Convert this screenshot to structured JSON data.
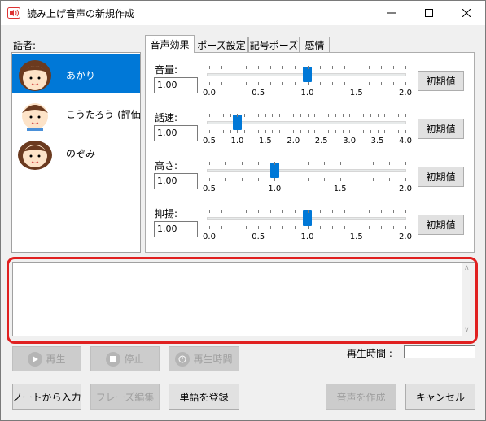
{
  "window": {
    "title": "読み上げ音声の新規作成"
  },
  "speakers": {
    "label": "話者:",
    "items": [
      {
        "name": "あかり",
        "selected": true
      },
      {
        "name": "こうたろう (評価版)",
        "selected": false
      },
      {
        "name": "のぞみ",
        "selected": false
      }
    ]
  },
  "tabs": [
    "音声効果",
    "ポーズ設定",
    "記号ポーズ",
    "感情"
  ],
  "sliders": [
    {
      "label": "音量:",
      "value": "1.00",
      "min": 0,
      "max": 2,
      "current": 1.0,
      "ticks": [
        "0.0",
        "0.5",
        "1.0",
        "1.5",
        "2.0"
      ],
      "reset": "初期値"
    },
    {
      "label": "話速:",
      "value": "1.00",
      "min": 0.5,
      "max": 4,
      "current": 1.0,
      "ticks": [
        "0.5",
        "1.0",
        "1.5",
        "2.0",
        "2.5",
        "3.0",
        "3.5",
        "4.0"
      ],
      "reset": "初期値"
    },
    {
      "label": "高さ:",
      "value": "1.00",
      "min": 0.5,
      "max": 2,
      "current": 1.0,
      "ticks": [
        "0.5",
        "1.0",
        "1.5",
        "2.0"
      ],
      "reset": "初期値"
    },
    {
      "label": "抑揚:",
      "value": "1.00",
      "min": 0,
      "max": 2,
      "current": 1.0,
      "ticks": [
        "0.0",
        "0.5",
        "1.0",
        "1.5",
        "2.0"
      ],
      "reset": "初期値"
    }
  ],
  "playback": {
    "play": "再生",
    "stop": "停止",
    "playtime_button": "再生時間",
    "playtime_label": "再生時間 :"
  },
  "bottom": {
    "from_note": "ノートから入力",
    "phrase_edit": "フレーズ編集",
    "register_word": "単語を登録",
    "create_audio": "音声を作成",
    "cancel": "キャンセル"
  }
}
